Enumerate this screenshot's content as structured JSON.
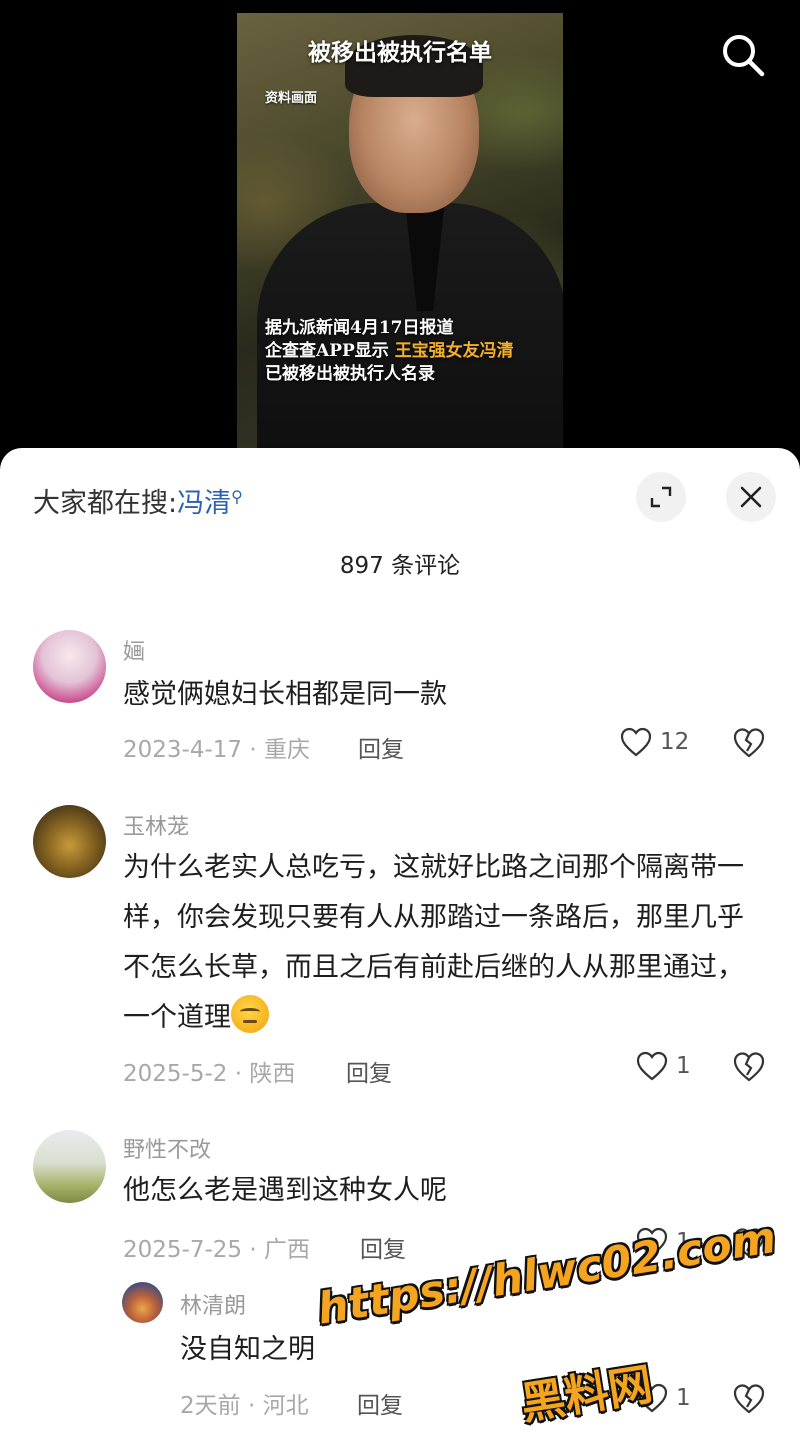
{
  "video": {
    "title": "被移出被执行名单",
    "tag": "资料画面",
    "caption_line1": "据九派新闻4月17日报道",
    "caption_line2_prefix": "企查查APP显示 ",
    "caption_line2_highlight": "王宝强女友冯清",
    "caption_line3": "已被移出被执行人名录",
    "search_icon": "search-icon"
  },
  "sheet": {
    "hot_search_label": "大家都在搜:",
    "hot_search_keyword": "冯清",
    "expand_icon": "expand-icon",
    "close_icon": "close-icon",
    "comment_count": "897",
    "comment_count_suffix": "条评论"
  },
  "comments": [
    {
      "username": "婳",
      "text": "感觉俩媳妇长相都是同一款",
      "date_location": "2023-4-17 · 重庆",
      "reply_label": "回复",
      "likes": "12"
    },
    {
      "username": "玉林茏",
      "text": "为什么老实人总吃亏，这就好比路之间那个隔离带一样，你会发现只要有人从那踏过一条路后，那里几乎不怎么长草，而且之后有前赴后继的人从那里通过，一个道理",
      "emoji": "thinking-emoji",
      "date_location": "2025-5-2 · 陕西",
      "reply_label": "回复",
      "likes": "1"
    },
    {
      "username": "野性不改",
      "text": "他怎么老是遇到这种女人呢",
      "date_location": "2025-7-25 · 广西",
      "reply_label": "回复",
      "likes": "1"
    },
    {
      "username": "林清朗",
      "text": "没自知之明",
      "date_location": "2天前 · 河北",
      "reply_label": "回复",
      "likes": "1"
    }
  ],
  "watermark": {
    "url": "https://hlwc02.com",
    "name": "黑料网"
  },
  "colors": {
    "link_blue": "#2c62b5",
    "caption_highlight": "#f4b02b",
    "watermark_orange": "#f4a41f"
  }
}
